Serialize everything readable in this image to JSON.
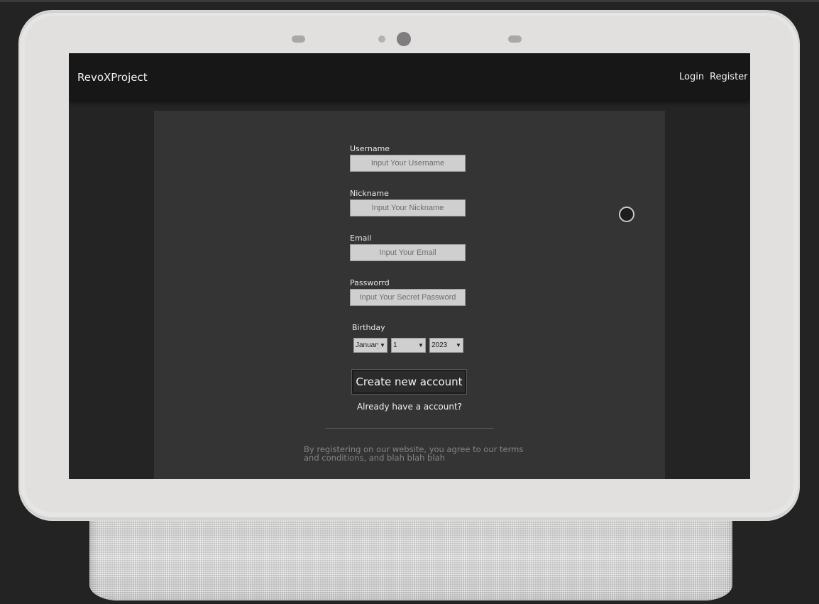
{
  "navbar": {
    "brand": "RevoXProject",
    "login_label": "Login",
    "register_label": "Register"
  },
  "form": {
    "username": {
      "label": "Username",
      "placeholder": "Input Your Username"
    },
    "nickname": {
      "label": "Nickname",
      "placeholder": "Input Your Nickname"
    },
    "email": {
      "label": "Email",
      "placeholder": "Input Your Email"
    },
    "password": {
      "label": "Passworrd",
      "placeholder": "Input Your Secret Password"
    },
    "birthday": {
      "label": "Birthday",
      "month": "January",
      "day": "1",
      "year": "2023"
    },
    "create_button": "Create new account",
    "already_link": "Already have a account?",
    "terms": "By registering on our website, you agree to our terms and conditions, and blah blah blah"
  },
  "colors": {
    "page_background": "#232323",
    "navbar": "#171717",
    "card": "#343434",
    "input": "#cfcfcf"
  }
}
